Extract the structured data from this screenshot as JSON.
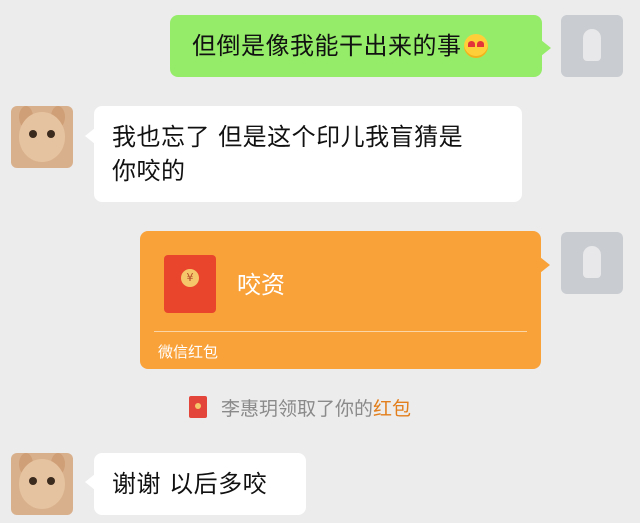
{
  "messages": {
    "m1": {
      "text": "但倒是像我能干出来的事",
      "emoji": "heart-eyes-emoji"
    },
    "m2": {
      "line1": "我也忘了 但是这个印儿我盲猜是",
      "line2": "你咬的"
    },
    "red_packet": {
      "title": "咬资",
      "label": "微信红包",
      "coin_symbol": "¥"
    },
    "notice": {
      "text_prefix": "李惠玥领取了你的",
      "link": "红包"
    },
    "m3": {
      "text": "谢谢 以后多咬"
    }
  },
  "colors": {
    "background": "#ececec",
    "sent_bubble": "#95ec69",
    "received_bubble": "#ffffff",
    "red_packet": "#f9a23a",
    "notice_link": "#e27e1b"
  }
}
